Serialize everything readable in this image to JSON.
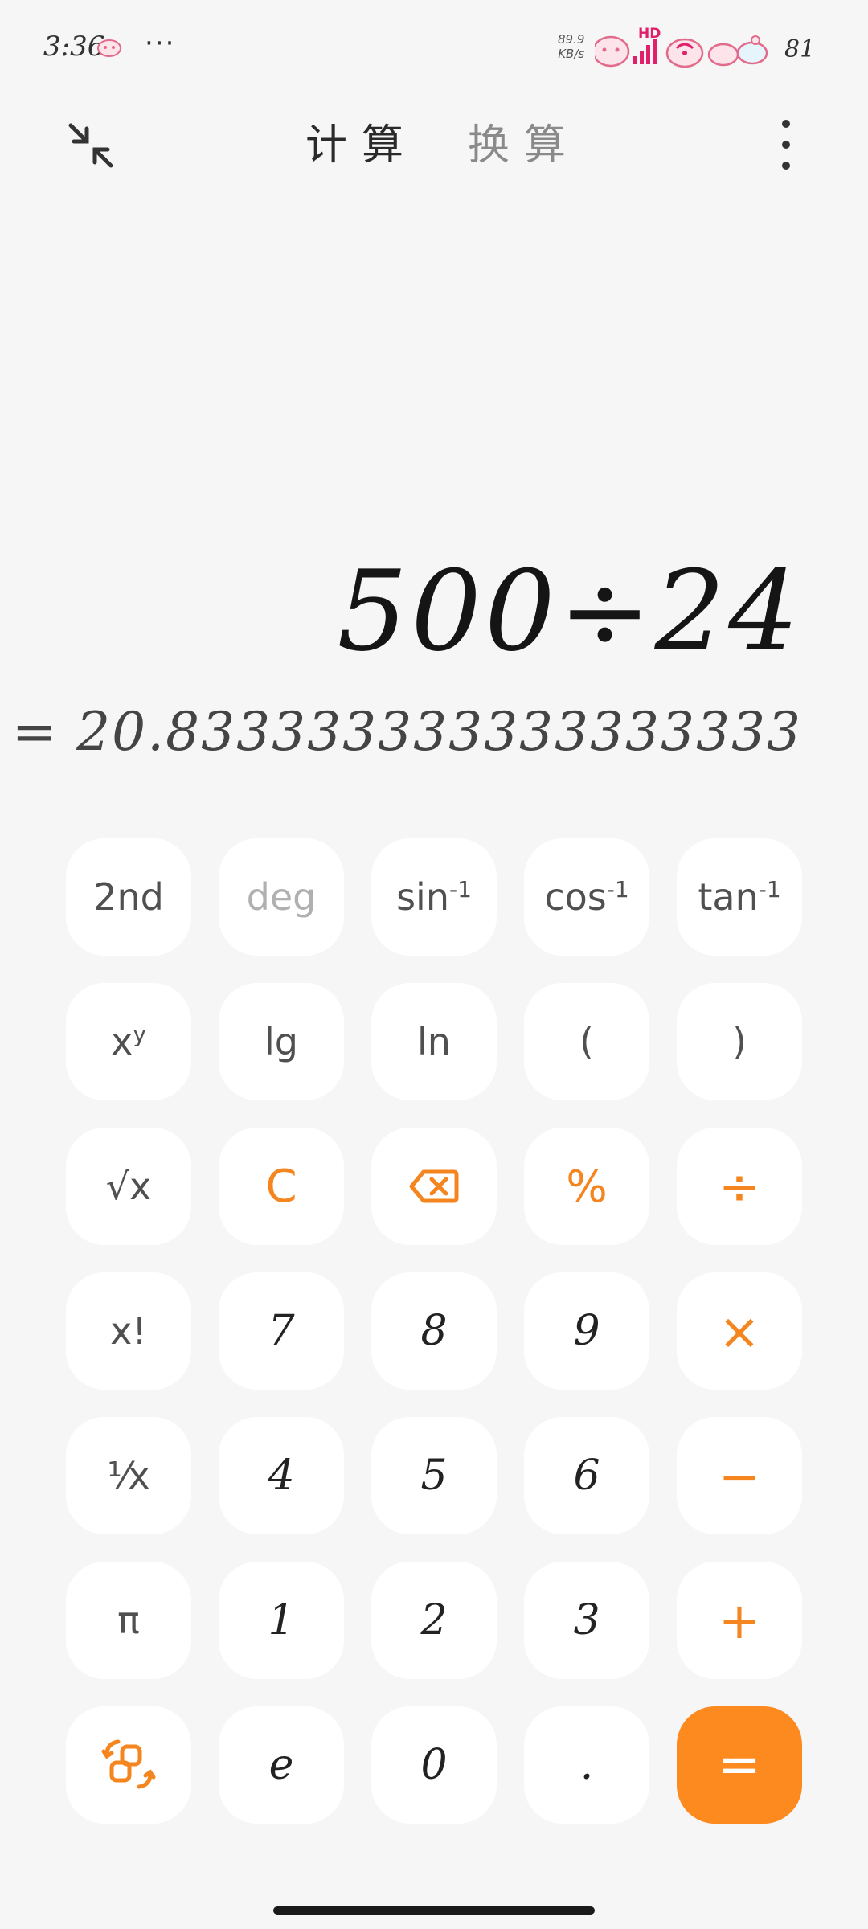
{
  "status_bar": {
    "time": "3:36",
    "dots": "···",
    "net_speed_value": "89.9",
    "net_speed_unit": "KB/s",
    "signal_label": "HD",
    "battery": "81"
  },
  "header": {
    "tab_calculate": "计算",
    "tab_convert": "换算"
  },
  "display": {
    "expression": "500÷24",
    "result": "= 20.833333333333333333"
  },
  "keypad": {
    "second": "2nd",
    "deg": "deg",
    "sin_inv_base": "sin",
    "cos_inv_base": "cos",
    "tan_inv_base": "tan",
    "inv_sup": "-1",
    "pow_base": "x",
    "pow_sup": "y",
    "lg": "lg",
    "ln": "ln",
    "paren_open": "(",
    "paren_close": ")",
    "sqrt": "√x",
    "clear": "C",
    "percent": "%",
    "divide": "÷",
    "factorial": "x!",
    "seven": "7",
    "eight": "8",
    "nine": "9",
    "multiply": "×",
    "reciprocal": "¹⁄x",
    "four": "4",
    "five": "5",
    "six": "6",
    "minus": "−",
    "pi": "π",
    "one": "1",
    "two": "2",
    "three": "3",
    "plus": "+",
    "e": "e",
    "zero": "0",
    "dot": ".",
    "equals": "="
  },
  "colors": {
    "accent": "#f5851f",
    "equals_bg": "#fd8a1e",
    "background": "#f6f6f6",
    "key_bg": "#ffffff",
    "status_pink": "#e0206a"
  },
  "icons": {
    "collapse": "collapse-arrows-icon",
    "more": "more-vertical-icon",
    "backspace": "backspace-icon",
    "switch_mode": "switch-mode-icon"
  }
}
